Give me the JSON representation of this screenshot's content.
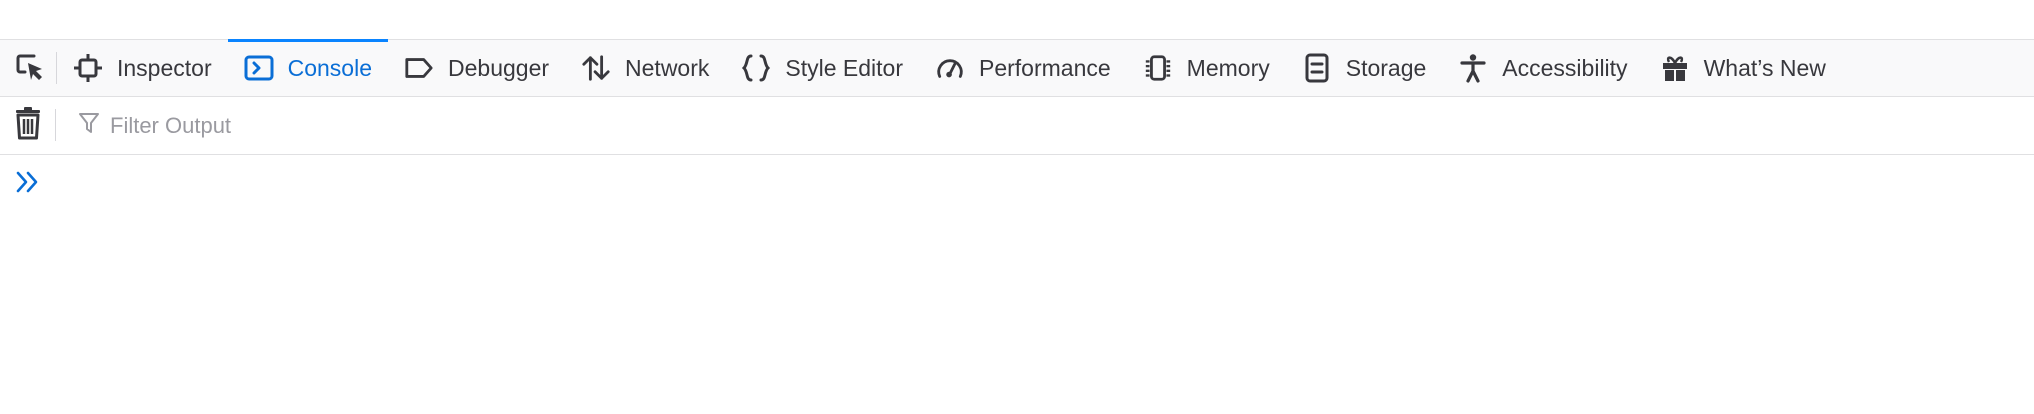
{
  "toolbox": {
    "picker_icon": "element-picker-icon",
    "tabs": [
      {
        "label": "Inspector",
        "icon": "inspector-icon",
        "selected": false
      },
      {
        "label": "Console",
        "icon": "console-icon",
        "selected": true
      },
      {
        "label": "Debugger",
        "icon": "debugger-icon",
        "selected": false
      },
      {
        "label": "Network",
        "icon": "network-icon",
        "selected": false
      },
      {
        "label": "Style Editor",
        "icon": "style-editor-icon",
        "selected": false
      },
      {
        "label": "Performance",
        "icon": "performance-icon",
        "selected": false
      },
      {
        "label": "Memory",
        "icon": "memory-icon",
        "selected": false
      },
      {
        "label": "Storage",
        "icon": "storage-icon",
        "selected": false
      },
      {
        "label": "Accessibility",
        "icon": "accessibility-icon",
        "selected": false
      },
      {
        "label": "What’s New",
        "icon": "gift-icon",
        "selected": false
      }
    ]
  },
  "console": {
    "clear_icon": "trash-icon",
    "filter": {
      "placeholder": "Filter Output",
      "value": ""
    },
    "prompt_icon": "double-chevron-right-icon",
    "input_value": ""
  },
  "colors": {
    "accent": "#0a84ff",
    "selected_text": "#0a6ed6",
    "text": "#38383d",
    "placeholder": "#9a9aa0",
    "toolbar_bg": "#f9f9fa",
    "border": "#e0e0e2"
  }
}
